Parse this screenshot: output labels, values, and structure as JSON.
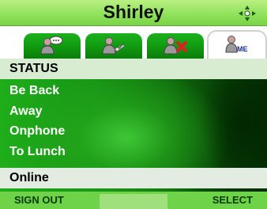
{
  "title": "Shirley",
  "nav_icon": "four-way-arrows-icon",
  "tabs": [
    {
      "icon": "contacts-chat-icon",
      "active": false
    },
    {
      "icon": "contact-accept-icon",
      "active": false
    },
    {
      "icon": "contact-block-icon",
      "active": false
    },
    {
      "icon": "me-profile-icon",
      "active": true
    }
  ],
  "list": {
    "header": "STATUS",
    "items": [
      "Be Back",
      "Away",
      "Onphone",
      "To Lunch",
      "Online"
    ],
    "selected_index": 4
  },
  "softkeys": {
    "left": "SIGN OUT",
    "right": "SELECT"
  }
}
